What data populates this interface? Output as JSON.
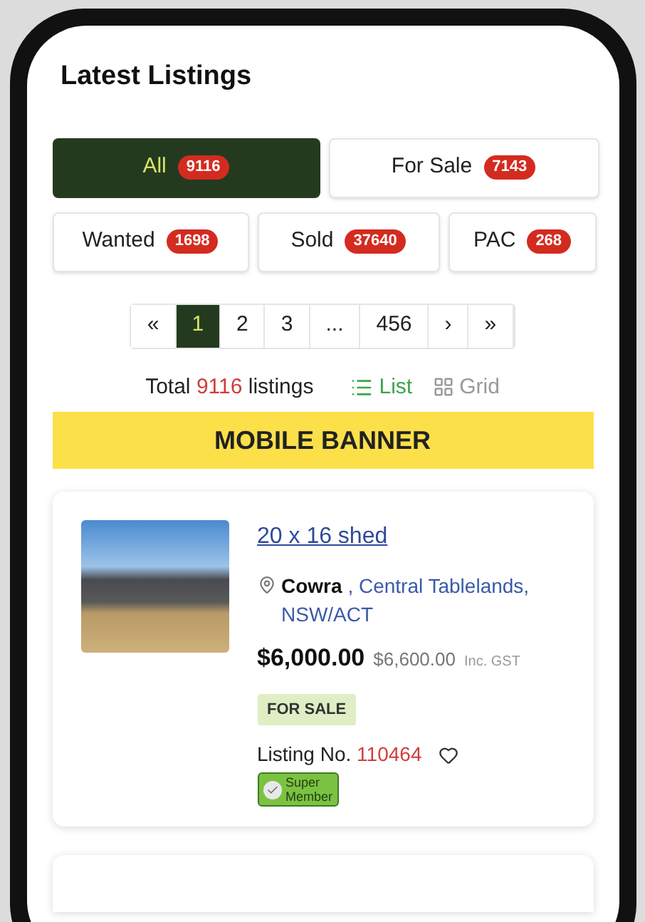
{
  "heading": "Latest Listings",
  "filters": [
    {
      "label": "All",
      "count": "9116",
      "selected": true
    },
    {
      "label": "For Sale",
      "count": "7143",
      "selected": false
    },
    {
      "label": "Wanted",
      "count": "1698",
      "selected": false
    },
    {
      "label": "Sold",
      "count": "37640",
      "selected": false
    },
    {
      "label": "PAC",
      "count": "268",
      "selected": false
    }
  ],
  "pagination": [
    {
      "label": "«",
      "selected": false
    },
    {
      "label": "1",
      "selected": true
    },
    {
      "label": "2",
      "selected": false
    },
    {
      "label": "3",
      "selected": false
    },
    {
      "label": "...",
      "selected": false
    },
    {
      "label": "456",
      "selected": false
    },
    {
      "label": "›",
      "selected": false
    },
    {
      "label": "»",
      "selected": false
    }
  ],
  "total": {
    "prefix": "Total",
    "count": "9116",
    "suffix": "listings"
  },
  "views": [
    {
      "kind": "list",
      "label": "List",
      "selected": true
    },
    {
      "kind": "grid",
      "label": "Grid",
      "selected": false
    }
  ],
  "banner": "MOBILE BANNER",
  "listing": {
    "title": "20 x 16 shed",
    "town": "Cowra",
    "separator": ",",
    "region": "Central Tablelands,",
    "state": "NSW/ACT",
    "price": "$6,000.00",
    "price_gst": "$6,600.00",
    "gst_label": "Inc. GST",
    "status": "FOR SALE",
    "listing_label": "Listing No.",
    "listing_no": "110464",
    "favorite": false,
    "badge": [
      "Super",
      "Member"
    ]
  }
}
